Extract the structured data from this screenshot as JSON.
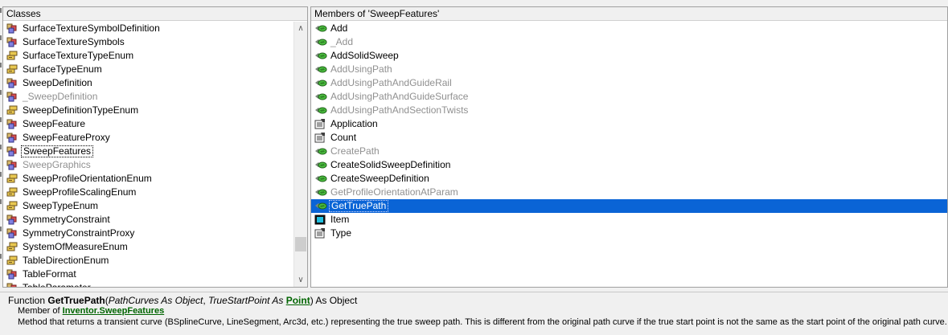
{
  "classes": {
    "header": "Classes",
    "items": [
      {
        "label": "SurfaceTextureSymbolDefinition",
        "icon": "class-icon"
      },
      {
        "label": "SurfaceTextureSymbols",
        "icon": "class-icon"
      },
      {
        "label": "SurfaceTextureTypeEnum",
        "icon": "enum-icon"
      },
      {
        "label": "SurfaceTypeEnum",
        "icon": "enum-icon"
      },
      {
        "label": "SweepDefinition",
        "icon": "class-icon"
      },
      {
        "label": "_SweepDefinition",
        "icon": "class-icon",
        "dim": true
      },
      {
        "label": "SweepDefinitionTypeEnum",
        "icon": "enum-icon"
      },
      {
        "label": "SweepFeature",
        "icon": "class-icon"
      },
      {
        "label": "SweepFeatureProxy",
        "icon": "class-icon"
      },
      {
        "label": "SweepFeatures",
        "icon": "class-icon",
        "focused": true
      },
      {
        "label": "SweepGraphics",
        "icon": "class-icon",
        "dim": true
      },
      {
        "label": "SweepProfileOrientationEnum",
        "icon": "enum-icon"
      },
      {
        "label": "SweepProfileScalingEnum",
        "icon": "enum-icon"
      },
      {
        "label": "SweepTypeEnum",
        "icon": "enum-icon"
      },
      {
        "label": "SymmetryConstraint",
        "icon": "class-icon"
      },
      {
        "label": "SymmetryConstraintProxy",
        "icon": "class-icon"
      },
      {
        "label": "SystemOfMeasureEnum",
        "icon": "enum-icon"
      },
      {
        "label": "TableDirectionEnum",
        "icon": "enum-icon"
      },
      {
        "label": "TableFormat",
        "icon": "class-icon"
      },
      {
        "label": "TableParameter",
        "icon": "class-icon"
      }
    ],
    "scroll_up_glyph": "∧",
    "scroll_down_glyph": "∨"
  },
  "members": {
    "header": "Members of 'SweepFeatures'",
    "items": [
      {
        "label": "Add",
        "icon": "method-icon"
      },
      {
        "label": "_Add",
        "icon": "method-icon",
        "dim": true
      },
      {
        "label": "AddSolidSweep",
        "icon": "method-icon"
      },
      {
        "label": "AddUsingPath",
        "icon": "method-icon",
        "dim": true
      },
      {
        "label": "AddUsingPathAndGuideRail",
        "icon": "method-icon",
        "dim": true
      },
      {
        "label": "AddUsingPathAndGuideSurface",
        "icon": "method-icon",
        "dim": true
      },
      {
        "label": "AddUsingPathAndSectionTwists",
        "icon": "method-icon",
        "dim": true
      },
      {
        "label": "Application",
        "icon": "property-icon"
      },
      {
        "label": "Count",
        "icon": "property-icon"
      },
      {
        "label": "CreatePath",
        "icon": "method-icon",
        "dim": true
      },
      {
        "label": "CreateSolidSweepDefinition",
        "icon": "method-icon"
      },
      {
        "label": "CreateSweepDefinition",
        "icon": "method-icon"
      },
      {
        "label": "GetProfileOrientationAtParam",
        "icon": "method-icon",
        "dim": true
      },
      {
        "label": "GetTruePath",
        "icon": "method-icon",
        "selected": true
      },
      {
        "label": "Item",
        "icon": "default-member-icon"
      },
      {
        "label": "Type",
        "icon": "property-icon"
      }
    ]
  },
  "details": {
    "sig_prefix": "Function ",
    "sig_name": "GetTruePath",
    "sig_open": "(",
    "param1": "PathCurves As Object",
    "sep": ", ",
    "param2_prefix": "TrueStartPoint As ",
    "param2_type": "Point",
    "sig_close": ") As Object",
    "member_of_prefix": "Member of ",
    "library": "Inventor",
    "dot": ".",
    "class_link": "SweepFeatures",
    "description": "Method that returns a transient curve (BSplineCurve, LineSegment, Arc3d, etc.) representing the true sweep path. This is different from the original path curve if the true start point is not the same as the start point of the original path curve."
  },
  "colors": {
    "selection": "#0a64d6",
    "dim_text": "#909090",
    "link": "#006400"
  }
}
